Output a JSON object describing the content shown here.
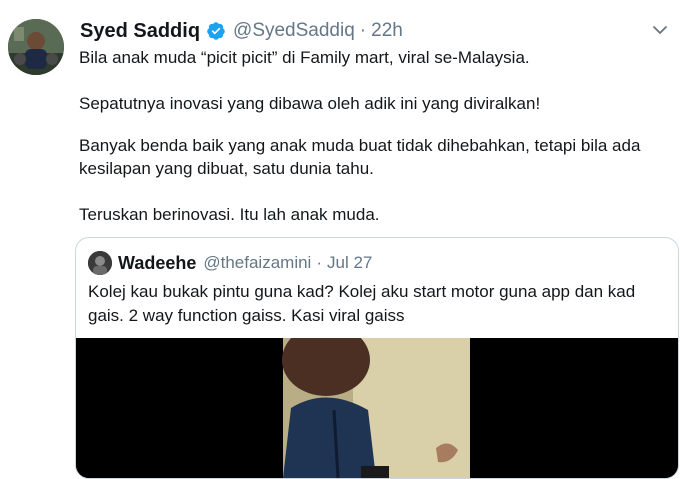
{
  "tweet": {
    "display_name": "Syed Saddiq",
    "handle": "@SyedSaddiq",
    "separator": "·",
    "time": "22h",
    "paragraphs": [
      "Bila anak muda “picit picit” di Family mart, viral se-Malaysia.",
      "Sepatutnya inovasi yang dibawa oleh adik ini yang diviralkan!",
      "Banyak benda baik yang anak muda buat tidak dihebahkan, tetapi bila ada kesilapan yang dibuat, satu dunia tahu.",
      "Teruskan berinovasi. Itu lah anak muda."
    ],
    "icons": {
      "verified": "verified-badge-icon",
      "menu": "chevron-down-icon"
    },
    "colors": {
      "verified": "#1da1f2",
      "secondary_text": "#657786",
      "border": "#ccd6dd"
    }
  },
  "quoted_tweet": {
    "display_name": "Wadeehe",
    "handle": "@thefaizamini",
    "separator": "·",
    "time": "Jul 27",
    "text": "Kolej kau bukak pintu guna kad? Kolej aku start motor guna app dan kad gais. 2 way function gaiss. Kasi viral gaiss"
  }
}
